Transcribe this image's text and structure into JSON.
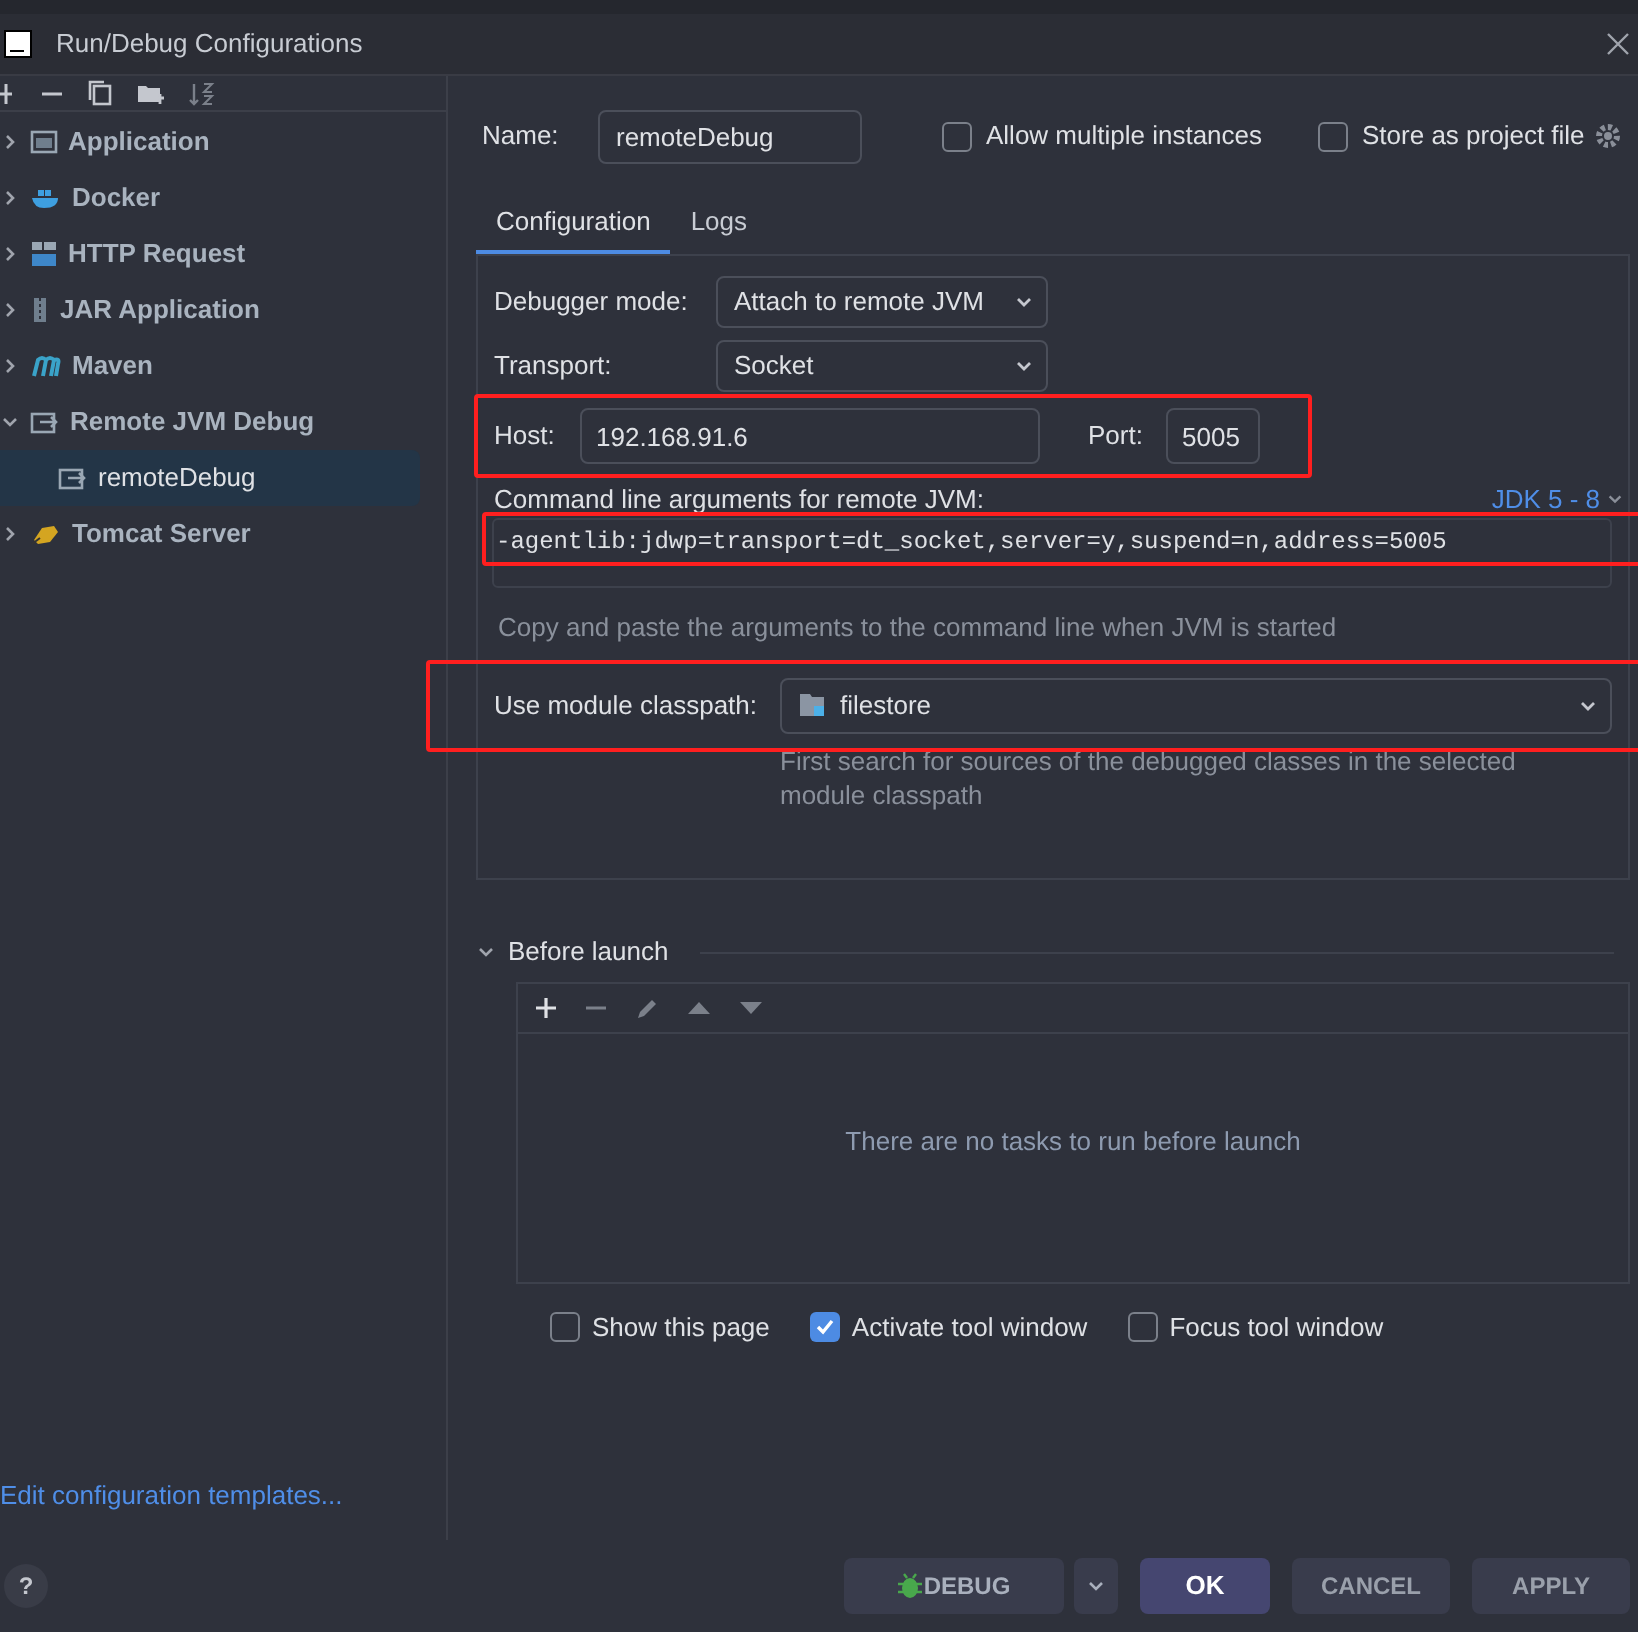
{
  "window": {
    "title": "Run/Debug Configurations"
  },
  "tree": [
    {
      "label": "Application",
      "kind": "application",
      "expanded": false,
      "selected": false
    },
    {
      "label": "Docker",
      "kind": "docker",
      "expanded": false,
      "selected": false
    },
    {
      "label": "HTTP Request",
      "kind": "http",
      "expanded": false,
      "selected": false
    },
    {
      "label": "JAR Application",
      "kind": "jar",
      "expanded": false,
      "selected": false
    },
    {
      "label": "Maven",
      "kind": "maven",
      "expanded": false,
      "selected": false
    },
    {
      "label": "Remote JVM Debug",
      "kind": "remote",
      "expanded": true,
      "selected": false,
      "children": [
        {
          "label": "remoteDebug",
          "kind": "remote",
          "selected": true
        }
      ]
    },
    {
      "label": "Tomcat Server",
      "kind": "tomcat",
      "expanded": false,
      "selected": false
    }
  ],
  "templates_link": "Edit configuration templates...",
  "name": {
    "label": "Name:",
    "value": "remoteDebug"
  },
  "header_options": [
    {
      "label": "Allow multiple instances",
      "checked": false
    },
    {
      "label": "Store as project file",
      "checked": false
    }
  ],
  "tabs": [
    {
      "label": "Configuration",
      "selected": true
    },
    {
      "label": "Logs",
      "selected": false
    }
  ],
  "debugger_mode": {
    "label": "Debugger mode:",
    "value": "Attach to remote JVM"
  },
  "transport": {
    "label": "Transport:",
    "value": "Socket"
  },
  "host": {
    "label": "Host:",
    "value": "192.168.91.6",
    "highlighted": true
  },
  "port": {
    "label": "Port:",
    "value": "5005"
  },
  "command_line": {
    "label": "Command line arguments for remote JVM:",
    "jdk": "JDK 5 - 8",
    "value": "-agentlib:jdwp=transport=dt_socket,server=y,suspend=n,address=5005",
    "highlighted": true,
    "hint": "Copy and paste the arguments to the command line when JVM is started"
  },
  "module_classpath": {
    "label": "Use module classpath:",
    "value": "filestore",
    "highlighted": true,
    "hint": "First search for sources of the debugged classes in the selected module classpath"
  },
  "before_launch": {
    "title": "Before launch",
    "expanded": true,
    "empty_text": "There are no tasks to run before launch"
  },
  "options": [
    {
      "label": "Show this page",
      "checked": false
    },
    {
      "label": "Activate tool window",
      "checked": true
    },
    {
      "label": "Focus tool window",
      "checked": false
    }
  ],
  "help": "?",
  "buttons": [
    {
      "label": "DEBUG",
      "kind": "debug"
    },
    {
      "label": "OK",
      "kind": "primary"
    },
    {
      "label": "CANCEL",
      "kind": "plain"
    },
    {
      "label": "APPLY",
      "kind": "plain"
    }
  ]
}
